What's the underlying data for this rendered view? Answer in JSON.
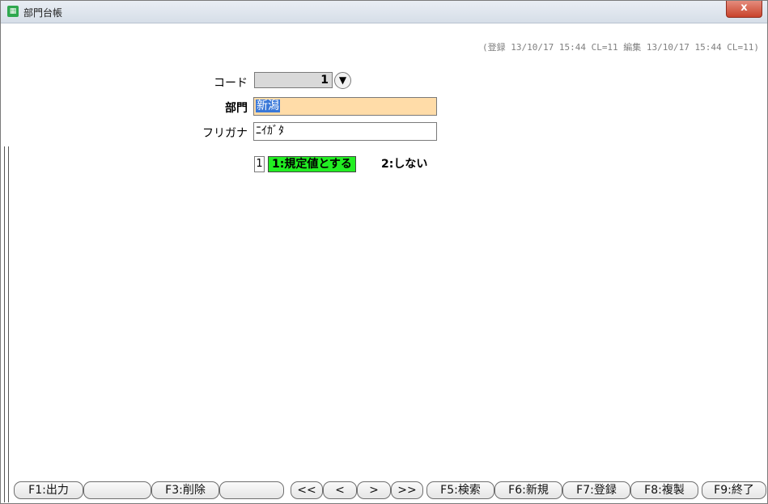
{
  "window": {
    "title": "部門台帳",
    "app_icon": "ledger-icon",
    "close_label": "x"
  },
  "audit_text": "(登録 13/10/17 15:44 CL=11  編集 13/10/17 15:44 CL=11)",
  "form": {
    "code_label": "コード",
    "code_value": "1",
    "code_dropdown_glyph": "▼",
    "dept_label": "部門",
    "dept_value": "新潟",
    "kana_label": "フリガナ",
    "kana_value": "ﾆｲｶﾞﾀ",
    "default_value": "1",
    "option1": "1:規定値とする",
    "option2": "2:しない"
  },
  "fkeys": {
    "f1": "F1:出力",
    "f2": "",
    "f3": "F3:削除",
    "f4": "",
    "first": "<<",
    "prev": "<",
    "next": ">",
    "last": ">>",
    "f5": "F5:検索",
    "f6": "F6:新規",
    "f7": "F7:登録",
    "f8": "F8:複製",
    "f9": "F9:終了"
  },
  "colors": {
    "dept_field_bg": "#ffdca8",
    "selection_bg": "#3a78d8",
    "option_active_bg": "#22ee22",
    "close_button": "#c9432c"
  }
}
